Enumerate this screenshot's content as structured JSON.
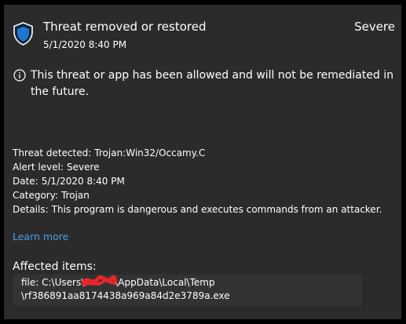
{
  "header": {
    "title": "Threat removed or restored",
    "date": "5/1/2020 8:40 PM",
    "severity": "Severe",
    "icon": "shield-icon"
  },
  "notice": {
    "icon": "info-icon",
    "text": "This threat or app has been allowed and will not be remediated in the future."
  },
  "details": {
    "threat_label": "Threat detected:",
    "threat_value": "Trojan:Win32/Occamy.C",
    "alert_label": "Alert level:",
    "alert_value": "Severe",
    "date_label": "Date:",
    "date_value": "5/1/2020 8:40 PM",
    "category_label": "Category:",
    "category_value": "Trojan",
    "details_label": "Details:",
    "details_value": "This program is dangerous and executes commands from an attacker."
  },
  "learn_more": "Learn more",
  "affected": {
    "heading": "Affected items:",
    "line1_prefix": "file: C:\\Users\\",
    "line1_suffix": "\\AppData\\Local\\Temp",
    "line2": "\\rf386891aa8174438a969a84d2e3789a.exe"
  },
  "colors": {
    "background": "#2b2b2b",
    "link": "#4a9fe6",
    "redaction": "#e8262a"
  }
}
